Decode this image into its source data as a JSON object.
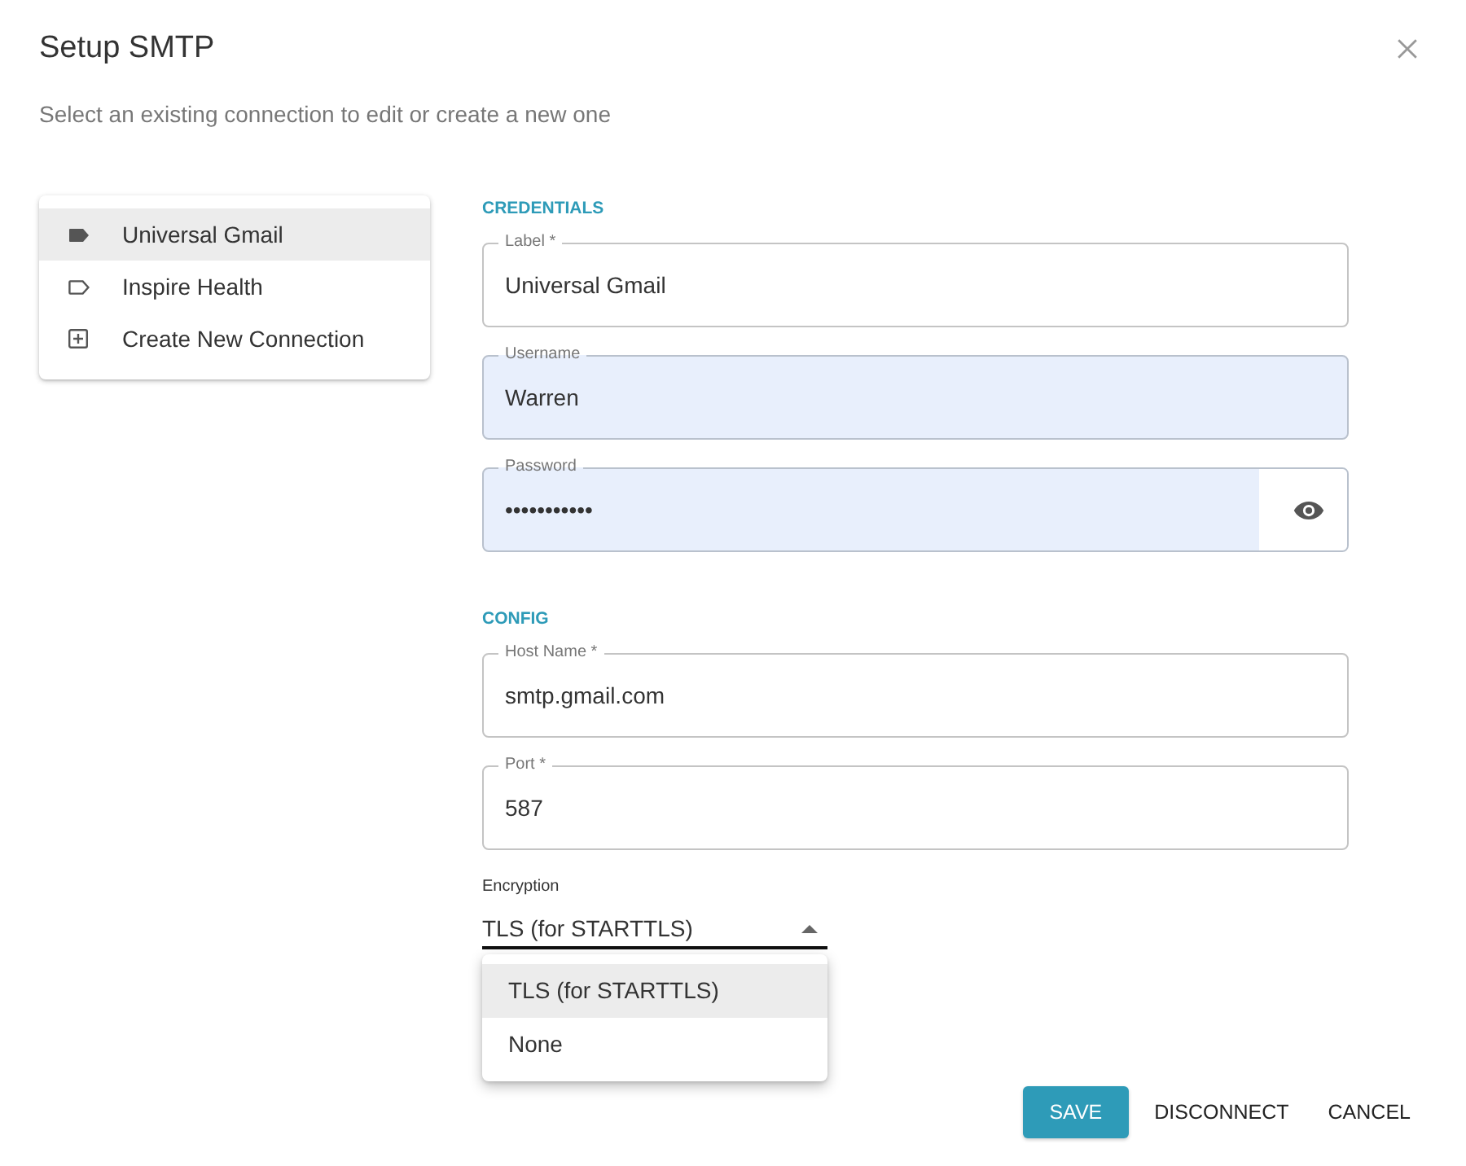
{
  "dialog": {
    "title": "Setup SMTP",
    "subtitle": "Select an existing connection to edit or create a new one"
  },
  "connections": [
    {
      "label": "Universal Gmail",
      "kind": "saved",
      "selected": true
    },
    {
      "label": "Inspire Health",
      "kind": "saved",
      "selected": false
    },
    {
      "label": "Create New Connection",
      "kind": "create",
      "selected": false
    }
  ],
  "sections": [
    {
      "heading": "CREDENTIALS",
      "fields": [
        {
          "label": "Label *",
          "value": "Universal Gmail",
          "kind": "text",
          "autofilled": false
        },
        {
          "label": "Username",
          "value": "Warren",
          "kind": "text",
          "autofilled": true
        },
        {
          "label": "Password",
          "value": "•••••••••••",
          "kind": "password",
          "autofilled": true
        }
      ]
    },
    {
      "heading": "CONFIG",
      "fields": [
        {
          "label": "Host Name *",
          "value": "smtp.gmail.com",
          "kind": "text",
          "autofilled": false
        },
        {
          "label": "Port *",
          "value": "587",
          "kind": "text",
          "autofilled": false
        }
      ],
      "select": {
        "label": "Encryption",
        "value": "TLS (for STARTTLS)",
        "expanded": true,
        "options": [
          {
            "label": "TLS (for STARTTLS)",
            "selected": true
          },
          {
            "label": "None",
            "selected": false
          }
        ]
      }
    }
  ],
  "buttons": [
    {
      "label": "SAVE",
      "kind": "primary"
    },
    {
      "label": "DISCONNECT",
      "kind": "text"
    },
    {
      "label": "CANCEL",
      "kind": "text"
    }
  ]
}
